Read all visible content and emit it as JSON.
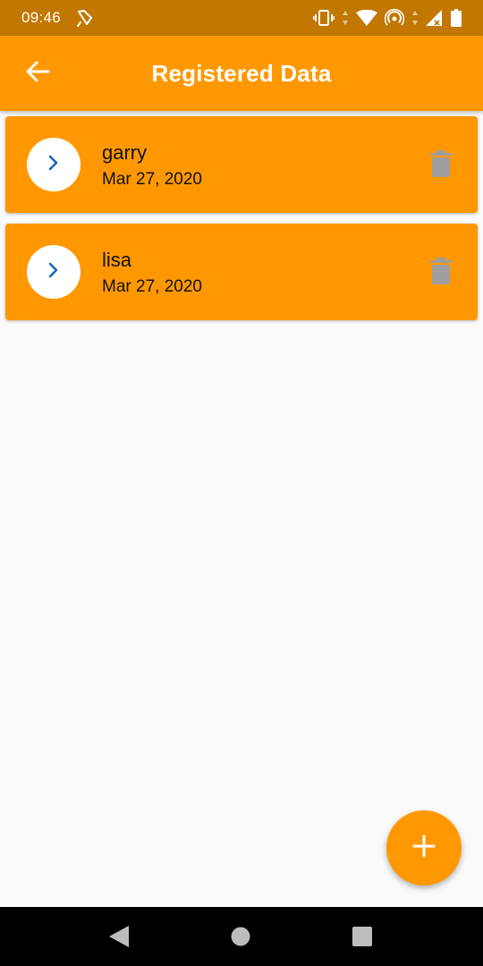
{
  "status_bar": {
    "time": "09:46"
  },
  "app_bar": {
    "title": "Registered Data",
    "back_icon": "arrow-left-icon"
  },
  "records": [
    {
      "name": "garry",
      "date": "Mar 27, 2020"
    },
    {
      "name": "lisa",
      "date": "Mar 27, 2020"
    }
  ],
  "fab": {
    "icon": "plus-icon"
  },
  "colors": {
    "status_bar": "#c17700",
    "primary": "#ff9800",
    "background": "#fafafa",
    "avatar_chevron": "#1565c0",
    "delete_icon": "#9e9e9e",
    "nav_bar": "#000000"
  }
}
